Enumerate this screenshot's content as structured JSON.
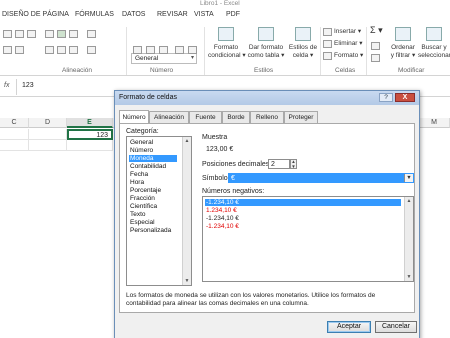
{
  "window": {
    "title": "Libro1 - Excel"
  },
  "ribbon_tabs": [
    "DISEÑO DE PÁGINA",
    "FÓRMULAS",
    "DATOS",
    "REVISAR",
    "VISTA",
    "PDF"
  ],
  "ribbon": {
    "groups": {
      "alineacion": "Alineación",
      "numero": "Número",
      "estilos": "Estilos",
      "celdas": "Celdas",
      "modificar": "Modificar"
    },
    "number_format": "General",
    "buttons": {
      "formato_condicional": [
        "Formato",
        "condicional ▾"
      ],
      "dar_formato_tabla": [
        "Dar formato",
        "como tabla ▾"
      ],
      "estilos_celda": [
        "Estilos de",
        "celda ▾"
      ],
      "insertar": "Insertar ▾",
      "eliminar": "Eliminar ▾",
      "formato": "Formato ▾",
      "ordenar": [
        "Ordenar",
        "y filtrar ▾"
      ],
      "buscar": [
        "Buscar y",
        "seleccionar"
      ]
    },
    "sigma": "Σ ▾"
  },
  "formula_bar": {
    "fx": "fx",
    "value": "123"
  },
  "grid": {
    "columns": [
      "C",
      "D",
      "E",
      "M"
    ],
    "selected_column": "E",
    "cell_value": "123"
  },
  "dialog": {
    "title": "Formato de celdas",
    "help": "?",
    "close": "X",
    "tabs": [
      "Número",
      "Alineación",
      "Fuente",
      "Borde",
      "Relleno",
      "Proteger"
    ],
    "active_tab": "Número",
    "category_label": "Categoría:",
    "categories": [
      "General",
      "Número",
      "Moneda",
      "Contabilidad",
      "Fecha",
      "Hora",
      "Porcentaje",
      "Fracción",
      "Científica",
      "Texto",
      "Especial",
      "Personalizada"
    ],
    "selected_category": "Moneda",
    "sample_label": "Muestra",
    "sample_value": "123,00 €",
    "decimal_label": "Posiciones decimales:",
    "decimal_value": "2",
    "symbol_label": "Símbolo:",
    "symbol_value": "€",
    "negative_label": "Números negativos:",
    "negatives": [
      {
        "text": "-1.234,10 €",
        "selected": true,
        "red": false
      },
      {
        "text": "1.234,10 €",
        "selected": false,
        "red": true
      },
      {
        "text": "-1.234,10 €",
        "selected": false,
        "red": false
      },
      {
        "text": "-1.234,10 €",
        "selected": false,
        "red": true
      }
    ],
    "description": "Los formatos de moneda se utilizan con los valores monetarios. Utilice los formatos de contabilidad para alinear las comas decimales en una columna.",
    "ok": "Aceptar",
    "cancel": "Cancelar"
  },
  "colors": {
    "excel_green": "#217346",
    "selection_blue": "#3399ff",
    "negative_red": "#e00000"
  }
}
